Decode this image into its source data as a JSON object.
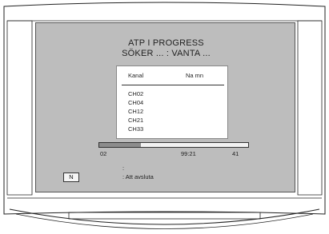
{
  "header": {
    "line1": "ATP I PROGRESS",
    "line2": "SÖKER ... : VANTA ..."
  },
  "list": {
    "column_kanal": "Kanal",
    "column_namn": "Na mn",
    "channels": [
      "CH02",
      "CH04",
      "CH12",
      "CH21",
      "CH33"
    ]
  },
  "progress": {
    "fraction": 0.28,
    "start": "02",
    "frequency": "99:21",
    "total": "41"
  },
  "footer": {
    "key_label": "N",
    "colon": ":",
    "exit_text": ": Att avsluta"
  },
  "colors": {
    "screen_bg": "#bdbdbd",
    "progress_fill": "#8c8c8c"
  }
}
